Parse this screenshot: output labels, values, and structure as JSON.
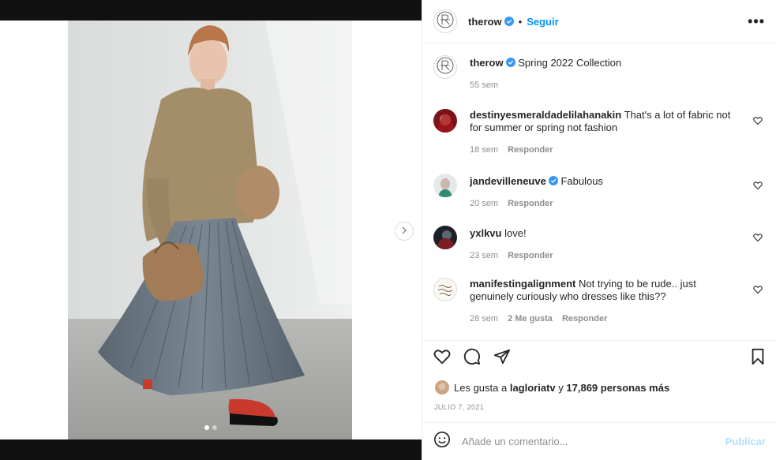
{
  "post": {
    "username": "therow",
    "follow_label": "Seguir",
    "separator": "•",
    "more_label": "•••",
    "caption": "Spring 2022 Collection",
    "caption_time": "55 sem"
  },
  "comments": [
    {
      "username": "destinyesmeraldadelilahanakin",
      "text": "That's a lot of fabric not for summer or spring not fashion",
      "time": "18 sem",
      "likes": "",
      "reply_label": "Responder"
    },
    {
      "username": "jandevilleneuve",
      "text": "Fabulous",
      "time": "20 sem",
      "likes": "",
      "reply_label": "Responder"
    },
    {
      "username": "yxlkvu",
      "text": "love!",
      "time": "23 sem",
      "likes": "",
      "reply_label": "Responder"
    },
    {
      "username": "manifestingalignment",
      "text": "Not trying to be rude.. just genuinely curiously who dresses like this??",
      "time": "28 sem",
      "likes": "2 Me gusta",
      "reply_label": "Responder"
    }
  ],
  "likes": {
    "prefix": "Les gusta a",
    "user": "lagloriatv",
    "connector": "y",
    "count": "17,869 personas más"
  },
  "date": "JULIO 7, 2021",
  "add_comment": {
    "placeholder": "Añade un comentario...",
    "publish_label": "Publicar"
  },
  "carousel": {
    "slides": 2,
    "active": 1
  },
  "colors": {
    "accent": "#0095f6",
    "publish_disabled": "#b2dffc",
    "muted": "#8e8e8e"
  },
  "icons": [
    "verified-icon",
    "heart-icon",
    "comment-icon",
    "share-icon",
    "bookmark-icon",
    "emoji-icon",
    "chevron-right-icon"
  ]
}
